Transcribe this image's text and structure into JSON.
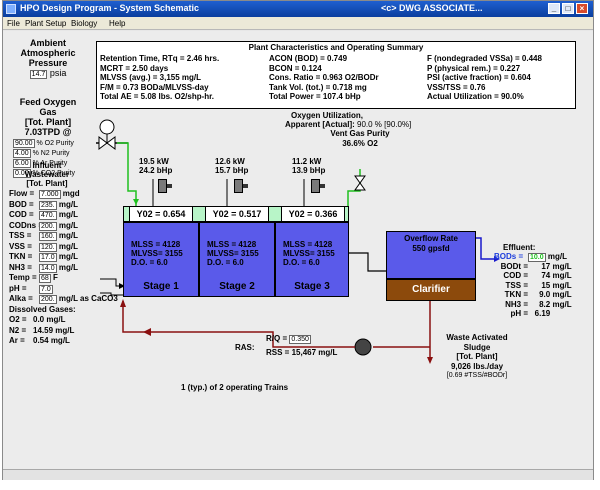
{
  "window": {
    "title": "HPO Design Program - System Schematic",
    "company": "<c> DWG ASSOCIATE..."
  },
  "menu": [
    "File",
    "Plant Setup",
    "Biology",
    "Help"
  ],
  "ambient": {
    "l1": "Ambient",
    "l2": "Atmospheric",
    "l3": "Pressure",
    "value": "14.7",
    "unit": "psia"
  },
  "feed_oxygen": {
    "l1": "Feed Oxygen",
    "l2": "Gas",
    "l3": "[Tot. Plant]",
    "rate": "7.03TPD @",
    "rows": [
      {
        "value": "90.00",
        "label": "% O2 Purity"
      },
      {
        "value": "4.00",
        "label": "% N2 Purity"
      },
      {
        "value": "6.00",
        "label": "% Ar Purity"
      },
      {
        "value": "0.00",
        "label": "% CO2 Purity"
      }
    ]
  },
  "summary": {
    "title": "Plant Characteristics and Operating Summary",
    "col1": [
      "Retention Time, RTq = 2.46 hrs.",
      "MCRT = 2.50 days",
      "MLVSS (avg.) = 3,155 mg/L",
      "F/M = 0.73 BODa/MLVSS-day",
      "Total AE = 5.08 lbs. O2/shp-hr."
    ],
    "col2": [
      "ACON (BOD) = 0.749",
      "BCON = 0.124",
      "Cons. Ratio = 0.963 O2/BODr",
      "Tank Vol. (tot.) = 0.718 mg",
      "Total Power = 107.4 bHp"
    ],
    "col3": [
      "F (nondegraded VSSa) = 0.448",
      "P (physical rem.) = 0.227",
      "PSI (active fraction) = 0.604",
      "VSS/TSS = 0.76",
      "Actual Utilization = 90.0%"
    ]
  },
  "oxygen_util": {
    "title": "Oxygen Utilization,",
    "apparent_label": "Apparent [Actual]:",
    "apparent_value": "90.0 % [90.0%]",
    "vent_l1": "Vent Gas Purity",
    "vent_value": "36.6% O2"
  },
  "stages": [
    {
      "kw": "19.5 kW",
      "bhp": "24.2 bHp",
      "y02_label": "Y02 =",
      "y02_value": "0.654",
      "mlss": "MLSS = 4128",
      "mlvss": "MLVSS= 3155",
      "do": "D.O. =",
      "do_value": "6.0",
      "name": "Stage 1"
    },
    {
      "kw": "12.6 kW",
      "bhp": "15.7 bHp",
      "y02_label": "Y02 =",
      "y02_value": "0.517",
      "mlss": "MLSS = 4128",
      "mlvss": "MLVSS= 3155",
      "do": "D.O. =",
      "do_value": "6.0",
      "name": "Stage 2"
    },
    {
      "kw": "11.2 kW",
      "bhp": "13.9 bHp",
      "y02_label": "Y02 =",
      "y02_value": "0.366",
      "mlss": "MLSS = 4128",
      "mlvss": "MLVSS= 3155",
      "do": "D.O. =",
      "do_value": "6.0",
      "name": "Stage 3"
    }
  ],
  "clarifier": {
    "overflow_label": "Overflow Rate",
    "overflow_value": "550 gpsfd",
    "name": "Clarifier"
  },
  "influent": {
    "l1": "Influent",
    "l2": "Wastewater",
    "l3": "[Tot. Plant]",
    "rows": [
      {
        "label": "Flow =",
        "value": "7.000",
        "unit": "mgd"
      },
      {
        "label": "BOD =",
        "value": "235.",
        "unit": "mg/L"
      },
      {
        "label": "COD =",
        "value": "470.",
        "unit": "mg/L"
      },
      {
        "label": "CODns =",
        "value": "200.",
        "unit": "mg/L"
      },
      {
        "label": "TSS =",
        "value": "160.",
        "unit": "mg/L"
      },
      {
        "label": "VSS =",
        "value": "120.",
        "unit": "mg/L"
      },
      {
        "label": "TKN =",
        "value": "17.0",
        "unit": "mg/L"
      },
      {
        "label": "NH3 =",
        "value": "14.0",
        "unit": "mg/L"
      },
      {
        "label": "Temp =",
        "value": "68",
        "unit": "F"
      },
      {
        "label": "pH =",
        "value": "7.0",
        "unit": ""
      },
      {
        "label": "Alka =",
        "value": "200.",
        "unit": "mg/L as CaCO3"
      }
    ],
    "gases_title": "Dissolved Gases:",
    "gases": [
      {
        "label": "O2 =",
        "value": "0.0",
        "unit": "mg/L"
      },
      {
        "label": "N2 =",
        "value": "14.59",
        "unit": "mg/L"
      },
      {
        "label": "Ar =",
        "value": "0.54",
        "unit": "mg/L"
      }
    ]
  },
  "effluent": {
    "title": "Effluent:",
    "rows": [
      {
        "label": "BODs =",
        "value": "10.0",
        "unit": "mg/L",
        "highlight": true
      },
      {
        "label": "BODt =",
        "value": "17",
        "unit": "mg/L",
        "highlight": false
      },
      {
        "label": "COD =",
        "value": "74",
        "unit": "mg/L",
        "highlight": false
      },
      {
        "label": "TSS =",
        "value": "15",
        "unit": "mg/L",
        "highlight": false
      },
      {
        "label": "TKN =",
        "value": "9.0",
        "unit": "mg/L",
        "highlight": false
      },
      {
        "label": "NH3 =",
        "value": "8.2",
        "unit": "mg/L",
        "highlight": false
      },
      {
        "label": "pH =",
        "value": "6.19",
        "unit": "",
        "highlight": false
      }
    ]
  },
  "ras": {
    "label": "RAS:",
    "rq": "R/Q =",
    "rq_value": "0.350",
    "rss": "RSS = 15,467 mg/L"
  },
  "was": {
    "l1": "Waste Activated",
    "l2": "Sludge",
    "l3": "[Tot. Plant]",
    "value": "9,026 lbs./day",
    "note": "[0.69 #TSS/#BODr]"
  },
  "footer": "1 (typ.) of 2 operating Trains",
  "colors": {
    "tank": "#5a5aea",
    "headspace": "#b8f5c8",
    "clarifier_sludge": "#8c4a0c",
    "pipe_green": "#1fc01f",
    "pipe_red": "#8a1010",
    "pipe_blue": "#1a1acc"
  }
}
